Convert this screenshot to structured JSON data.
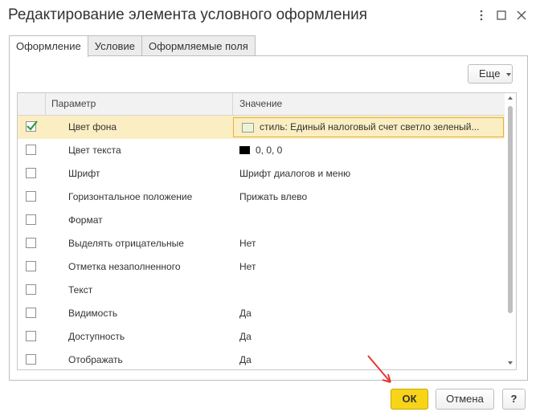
{
  "window": {
    "title": "Редактирование элемента условного оформления",
    "more_icon": "more-vertical-icon",
    "maximize_icon": "maximize-icon",
    "close_icon": "close-icon"
  },
  "tabs": [
    {
      "label": "Оформление",
      "active": true
    },
    {
      "label": "Условие",
      "active": false
    },
    {
      "label": "Оформляемые поля",
      "active": false
    }
  ],
  "toolbar": {
    "more_label": "Еще"
  },
  "table": {
    "columns": [
      "Параметр",
      "Значение"
    ],
    "rows": [
      {
        "checked": true,
        "param": "Цвет фона",
        "value": "стиль: Единый налоговый счет светло зеленый...",
        "swatch": "#ebf5d6",
        "selected": true
      },
      {
        "checked": false,
        "param": "Цвет текста",
        "value": "0, 0, 0",
        "swatch": "#000000"
      },
      {
        "checked": false,
        "param": "Шрифт",
        "value": "Шрифт диалогов и меню"
      },
      {
        "checked": false,
        "param": "Горизонтальное положение",
        "value": "Прижать влево"
      },
      {
        "checked": false,
        "param": "Формат",
        "value": ""
      },
      {
        "checked": false,
        "param": "Выделять отрицательные",
        "value": "Нет"
      },
      {
        "checked": false,
        "param": "Отметка незаполненного",
        "value": "Нет"
      },
      {
        "checked": false,
        "param": "Текст",
        "value": ""
      },
      {
        "checked": false,
        "param": "Видимость",
        "value": "Да"
      },
      {
        "checked": false,
        "param": "Доступность",
        "value": "Да"
      },
      {
        "checked": false,
        "param": "Отображать",
        "value": "Да"
      }
    ]
  },
  "footer": {
    "ok_label": "ОК",
    "cancel_label": "Отмена",
    "help_label": "?"
  },
  "colors": {
    "accent_ok": "#f7d417",
    "selection": "#fbeec2",
    "selection_border": "#e2b13c",
    "check": "#2e9b3f",
    "annotation_arrow": "#e53935"
  }
}
